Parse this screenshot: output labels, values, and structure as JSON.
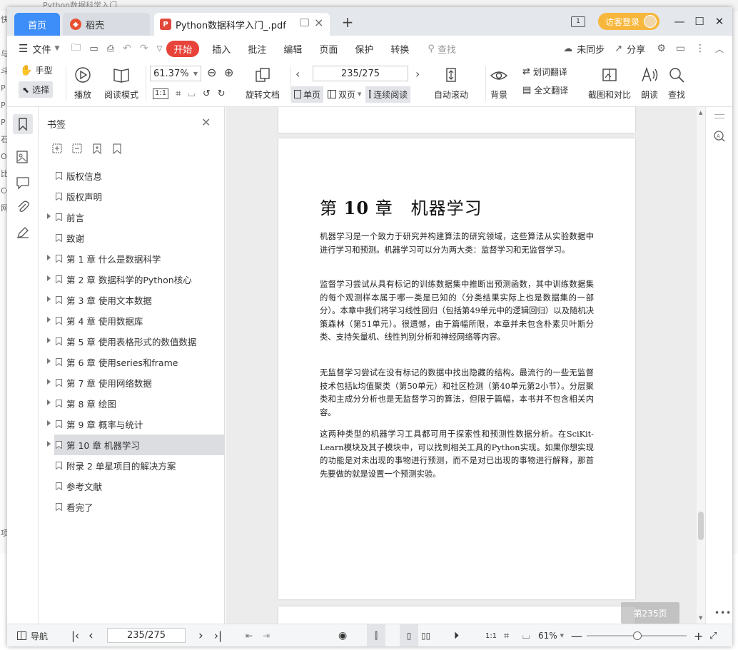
{
  "background_window": {
    "title": "Python数据科学入门",
    "left_letters": [
      "快",
      "",
      "与",
      "斗",
      "P",
      "P",
      "P",
      "石",
      "Or",
      "比",
      "CC",
      "网",
      "",
      "",
      "",
      "",
      "",
      "",
      "",
      "",
      "",
      "",
      "",
      "",
      "",
      "",
      "",
      "",
      "",
      "",
      "项"
    ]
  },
  "tabs": {
    "home": "首页",
    "daoke": "稻壳",
    "pdf": "Python数据科学入门_.pdf"
  },
  "window": {
    "login": "访客登录"
  },
  "menu": {
    "file": "文件",
    "start": "开始",
    "items": [
      "插入",
      "批注",
      "编辑",
      "页面",
      "保护",
      "转换"
    ],
    "search": "查找",
    "unsync": "未同步",
    "share": "分享"
  },
  "ribbon": {
    "hand": "手型",
    "select": "选择",
    "play": "播放",
    "read_mode": "阅读模式",
    "zoom": "61.37%",
    "rotate": "旋转文档",
    "page_current": "235/275",
    "single": "单页",
    "double": "双页",
    "continuous": "连续阅读",
    "auto_scroll": "自动滚动",
    "background": "背景",
    "word_translate": "划词翻译",
    "full_translate": "全文翻译",
    "compare": "截图和对比",
    "read_aloud": "朗读",
    "find": "查找"
  },
  "bookmarks": {
    "title": "书签",
    "items": [
      {
        "label": "版权信息",
        "expandable": false,
        "selected": false
      },
      {
        "label": "版权声明",
        "expandable": false,
        "selected": false
      },
      {
        "label": "前言",
        "expandable": true,
        "selected": false
      },
      {
        "label": "致谢",
        "expandable": false,
        "selected": false
      },
      {
        "label": "第 1 章  什么是数据科学",
        "expandable": true,
        "selected": false
      },
      {
        "label": "第 2 章  数据科学的Python核心",
        "expandable": true,
        "selected": false
      },
      {
        "label": "第 3 章  使用文本数据",
        "expandable": true,
        "selected": false
      },
      {
        "label": "第 4 章  使用数据库",
        "expandable": true,
        "selected": false
      },
      {
        "label": "第 5 章  使用表格形式的数值数据",
        "expandable": true,
        "selected": false
      },
      {
        "label": "第 6 章  使用series和frame",
        "expandable": true,
        "selected": false
      },
      {
        "label": "第 7 章  使用网络数据",
        "expandable": true,
        "selected": false
      },
      {
        "label": "第 8 章  绘图",
        "expandable": true,
        "selected": false
      },
      {
        "label": "第 9 章  概率与统计",
        "expandable": true,
        "selected": false
      },
      {
        "label": "第 10 章  机器学习",
        "expandable": true,
        "selected": true
      },
      {
        "label": "附录 2  单星项目的解决方案",
        "expandable": false,
        "selected": false
      },
      {
        "label": "参考文献",
        "expandable": false,
        "selected": false
      },
      {
        "label": "看完了",
        "expandable": false,
        "selected": false
      }
    ]
  },
  "page": {
    "title_prefix": "第",
    "title_number": "10",
    "title_suffix": "章　机器学习",
    "paragraphs": [
      "机器学习是一个致力于研究并构建算法的研究领域，这些算法从实验数据中进行学习和预测。机器学习可以分为两大类：监督学习和无监督学习。",
      "监督学习尝试从具有标记的训练数据集中推断出预测函数，其中训练数据集的每个观测样本属于哪一类是已知的（分类结果实际上也是数据集的一部分）。本章中我们将学习线性回归（包括第49单元中的逻辑回归）以及随机决策森林（第51单元）。很遗憾，由于篇幅所限，本章并未包含朴素贝叶斯分类、支持矢量机、线性判别分析和神经网络等内容。",
      "无监督学习尝试在没有标记的数据中找出隐藏的结构。最流行的一些无监督技术包括k均值聚类（第50单元）和社区检测（第40单元第2小节）。分层聚类和主成分分析也是无监督学习的算法，但限于篇幅，本书并不包含相关内容。",
      "这两种类型的机器学习工具都可用于探索性和预测性数据分析。在SciKit-Learn模块及其子模块中，可以找到相关工具的Python实现。如果你想实现的功能是对未出现的事物进行预测，而不是对已出现的事物进行解释，那首先要做的就是设置一个预测实验。"
    ],
    "indicator": "第235页"
  },
  "status": {
    "nav": "导航",
    "page": "235/275",
    "zoom": "61%",
    "zoom_level": 0.61
  }
}
